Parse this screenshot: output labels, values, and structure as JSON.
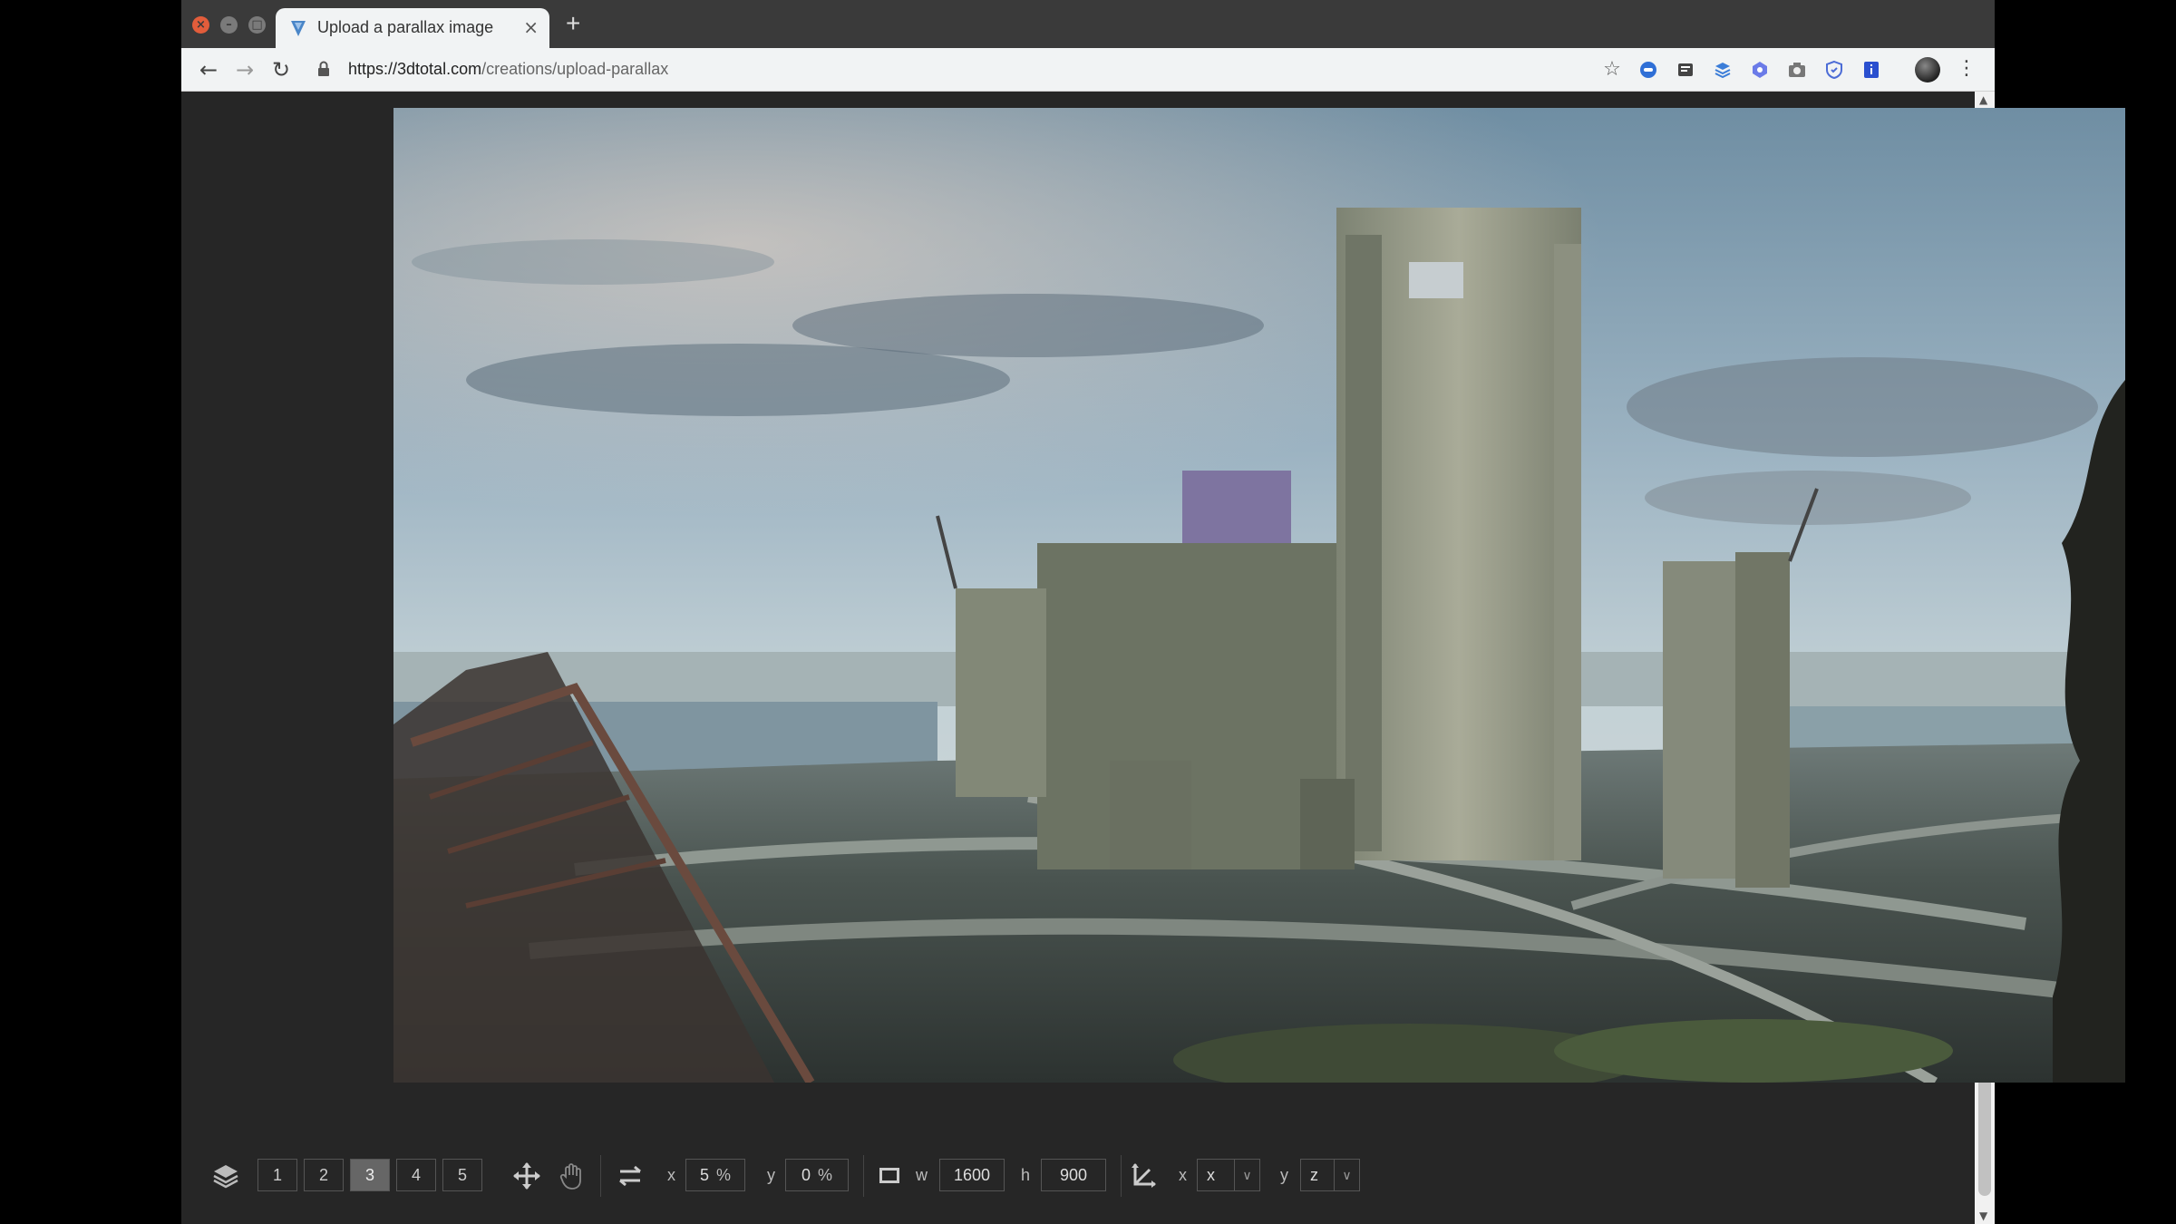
{
  "browser": {
    "tab_title": "Upload a parallax image",
    "tab_close": "×",
    "new_tab": "+",
    "url_host": "https://3dtotal.com",
    "url_path": "/creations/upload-parallax"
  },
  "controls": {
    "layers": [
      "1",
      "2",
      "3",
      "4",
      "5"
    ],
    "active_layer": "3",
    "offset": {
      "x_label": "x",
      "x_value": "5",
      "x_unit": "%",
      "y_label": "y",
      "y_value": "0",
      "y_unit": "%"
    },
    "size": {
      "w_label": "w",
      "w_value": "1600",
      "h_label": "h",
      "h_value": "900"
    },
    "axis": {
      "x_label": "x",
      "x_value": "x",
      "y_label": "y",
      "y_value": "z"
    }
  },
  "colors": {
    "accent_close": "#e25d3b",
    "active_layer_bg": "#666666",
    "page_bg": "#262626"
  },
  "icons": [
    "layers-icon",
    "move-icon",
    "hand-icon",
    "swap-icon",
    "frame-icon",
    "axis-icon"
  ]
}
